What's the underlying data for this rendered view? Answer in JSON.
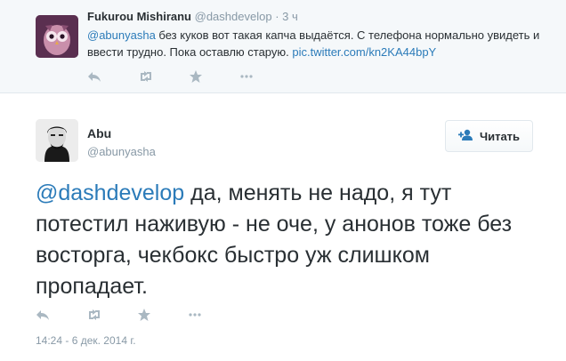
{
  "parent_tweet": {
    "name": "Fukurou Mishiranu",
    "handle": "@dashdevelop",
    "separator": "·",
    "time": "3 ч",
    "mention": "@abunyasha",
    "text": " без куков вот такая капча выдаётся. С телефона нормально увидеть и ввести трудно. Пока оставлю старую. ",
    "link": "pic.twitter.com/kn2KA44bpY",
    "actions": [
      "reply-icon",
      "retweet-icon",
      "favorite-icon",
      "more-icon"
    ]
  },
  "main_tweet": {
    "name": "Abu",
    "handle": "@abunyasha",
    "follow_label": "Читать",
    "mention": "@dashdevelop",
    "text": " да, менять не надо, я тут потестил наживую - не оче, у анонов тоже без восторга, чекбокс быстро уж слишком пропадает.",
    "timestamp": "14:24 - 6 дек. 2014 г.",
    "actions": [
      "reply-icon",
      "retweet-icon",
      "favorite-icon",
      "more-icon"
    ]
  },
  "colors": {
    "link": "#2b7bb9",
    "muted": "#8899a6",
    "text": "#292f33",
    "icon": "#aab8c2",
    "parent_bg": "#f5f8fa"
  }
}
